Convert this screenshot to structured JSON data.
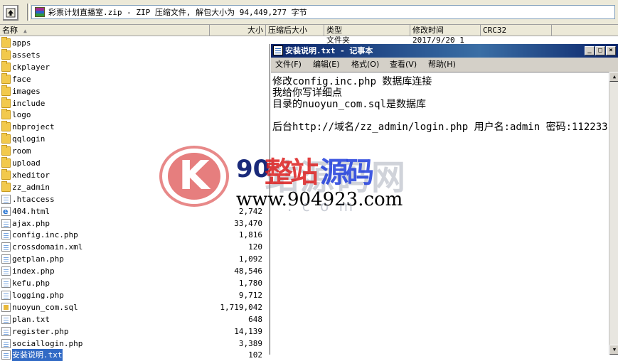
{
  "archive": {
    "path": "彩票计划直播室.zip - ZIP 压缩文件, 解包大小为 94,449,277 字节"
  },
  "columns": {
    "name": "名称",
    "size": "大小",
    "packed": "压缩后大小",
    "type": "类型",
    "modified": "修改时间",
    "crc": "CRC32"
  },
  "partial_row": {
    "type": "文件夹",
    "modified": "2017/9/20 1"
  },
  "files": [
    {
      "name": "apps",
      "size": "",
      "kind": "folder"
    },
    {
      "name": "assets",
      "size": "",
      "kind": "folder"
    },
    {
      "name": "ckplayer",
      "size": "",
      "kind": "folder"
    },
    {
      "name": "face",
      "size": "",
      "kind": "folder"
    },
    {
      "name": "images",
      "size": "",
      "kind": "folder"
    },
    {
      "name": "include",
      "size": "",
      "kind": "folder"
    },
    {
      "name": "logo",
      "size": "",
      "kind": "folder"
    },
    {
      "name": "nbproject",
      "size": "",
      "kind": "folder"
    },
    {
      "name": "qqlogin",
      "size": "",
      "kind": "folder"
    },
    {
      "name": "room",
      "size": "",
      "kind": "folder"
    },
    {
      "name": "upload",
      "size": "",
      "kind": "folder"
    },
    {
      "name": "xheditor",
      "size": "",
      "kind": "folder"
    },
    {
      "name": "zz_admin",
      "size": "",
      "kind": "folder"
    },
    {
      "name": ".htaccess",
      "size": "",
      "kind": "file"
    },
    {
      "name": "404.html",
      "size": "2,742",
      "kind": "html"
    },
    {
      "name": "ajax.php",
      "size": "33,470",
      "kind": "file"
    },
    {
      "name": "config.inc.php",
      "size": "1,816",
      "kind": "file"
    },
    {
      "name": "crossdomain.xml",
      "size": "120",
      "kind": "file"
    },
    {
      "name": "getplan.php",
      "size": "1,092",
      "kind": "file"
    },
    {
      "name": "index.php",
      "size": "48,546",
      "kind": "file"
    },
    {
      "name": "kefu.php",
      "size": "1,780",
      "kind": "file"
    },
    {
      "name": "logging.php",
      "size": "9,712",
      "kind": "file"
    },
    {
      "name": "nuoyun_com.sql",
      "size": "1,719,042",
      "kind": "sql"
    },
    {
      "name": "plan.txt",
      "size": "648",
      "kind": "file"
    },
    {
      "name": "register.php",
      "size": "14,139",
      "kind": "file"
    },
    {
      "name": "sociallogin.php",
      "size": "3,389",
      "kind": "file"
    },
    {
      "name": "安装说明.txt",
      "size": "102",
      "kind": "file",
      "selected": true
    }
  ],
  "notepad": {
    "title": "安装说明.txt - 记事本",
    "menu": [
      "文件(F)",
      "编辑(E)",
      "格式(O)",
      "查看(V)",
      "帮助(H)"
    ],
    "lines": [
      "修改config.inc.php 数据库连接",
      "我给你写详细点",
      "目录的nuoyun_com.sql是数据库",
      "",
      "后台http://域名/zz_admin/login.php 用户名:admin 密码:112233"
    ]
  },
  "watermark": {
    "logo_letter": "K",
    "prefix": "90",
    "brand_red": "整站",
    "brand_blue": "源码",
    "brand_shadow": "站源码网",
    "url": "www.904923.com",
    "url_shadow": ". c o m"
  },
  "colors": {
    "title_bar": "#0a246a",
    "selection": "#316ac5",
    "chrome": "#ece9d8",
    "watermark_red": "#d62828",
    "watermark_blue": "#1e3cdc"
  }
}
